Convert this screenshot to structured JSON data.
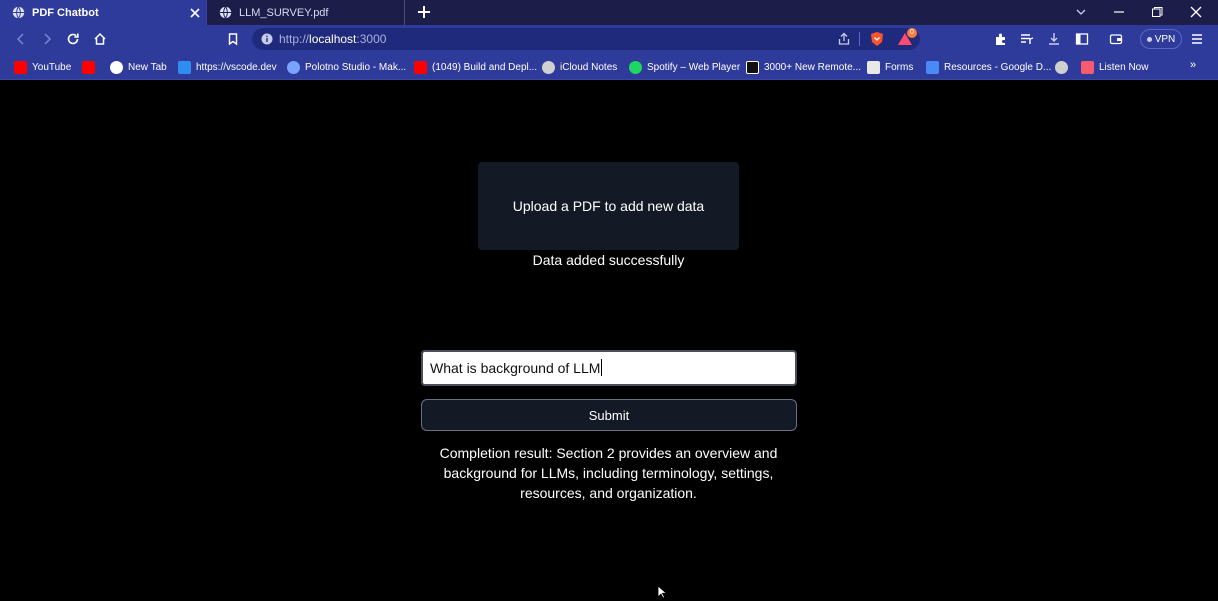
{
  "tabs": [
    {
      "title": "PDF Chatbot",
      "active": true
    },
    {
      "title": "LLM_SURVEY.pdf",
      "active": false
    }
  ],
  "address": {
    "scheme": "http://",
    "host": "localhost",
    "port": ":3000"
  },
  "vpn_label": "VPN",
  "shields_badge": "0",
  "bookmarks": [
    {
      "label": "YouTube",
      "icon": "youtube-icon",
      "color": "#ff0000"
    },
    {
      "label": "",
      "icon": "youtube-icon",
      "color": "#ff0000"
    },
    {
      "label": "New Tab",
      "icon": "speedometer-icon",
      "color": "#ffffff"
    },
    {
      "label": "https://vscode.dev",
      "icon": "vscode-icon",
      "color": "#2f8cf0"
    },
    {
      "label": "Polotno Studio - Mak...",
      "icon": "polotno-icon",
      "color": "#7aa2ff"
    },
    {
      "label": "(1049) Build and Depl...",
      "icon": "youtube-icon",
      "color": "#ff0000"
    },
    {
      "label": "iCloud Notes",
      "icon": "apple-icon",
      "color": "#d0d0d0"
    },
    {
      "label": "Spotify – Web Player",
      "icon": "spotify-icon",
      "color": "#1ed760"
    },
    {
      "label": "3000+ New Remote...",
      "icon": "remote-jobs-icon",
      "color": "#111111"
    },
    {
      "label": "Forms",
      "icon": "forms-icon",
      "color": "#e8e8e8"
    },
    {
      "label": "Resources - Google D...",
      "icon": "google-docs-icon",
      "color": "#4a8af4"
    },
    {
      "label": "",
      "icon": "globe-icon",
      "color": "#d0d0d0"
    },
    {
      "label": "Listen Now",
      "icon": "apple-music-icon",
      "color": "#fa5a6e"
    }
  ],
  "bookmarks_more": "»",
  "page": {
    "upload_label": "Upload a PDF to add new data",
    "status_message": "Data added successfully",
    "query_value": "What is background of LLM",
    "submit_label": "Submit",
    "result_text": "Completion result: Section 2 provides an overview and background for LLMs, including terminology, settings, resources, and organization."
  },
  "colors": {
    "chrome_accent": "#2e3b9a",
    "tabbar": "#1d1d4a",
    "page_bg": "#000000",
    "card_bg": "#131a26"
  }
}
